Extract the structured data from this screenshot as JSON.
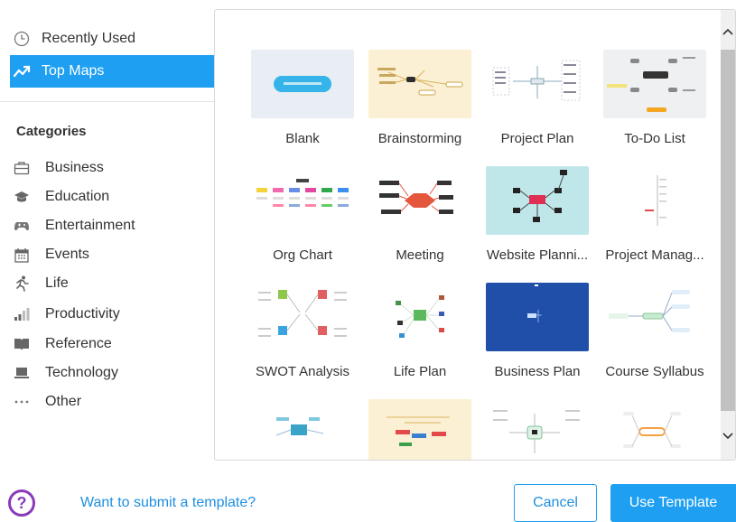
{
  "sidebar": {
    "nav": [
      {
        "label": "Recently Used",
        "icon": "clock-icon"
      },
      {
        "label": "Top Maps",
        "icon": "trending-icon",
        "active": true
      }
    ],
    "categories_title": "Categories",
    "categories": [
      {
        "label": "Business",
        "icon": "briefcase-icon"
      },
      {
        "label": "Education",
        "icon": "graduation-cap-icon"
      },
      {
        "label": "Entertainment",
        "icon": "gamepad-icon"
      },
      {
        "label": "Events",
        "icon": "calendar-icon"
      },
      {
        "label": "Life",
        "icon": "running-person-icon"
      },
      {
        "label": "Productivity",
        "icon": "bar-chart-icon"
      },
      {
        "label": "Reference",
        "icon": "book-icon"
      },
      {
        "label": "Technology",
        "icon": "laptop-icon"
      },
      {
        "label": "Other",
        "icon": "ellipsis-icon"
      }
    ]
  },
  "templates": [
    {
      "label": "Blank",
      "thumb_bg": "#e8eef3"
    },
    {
      "label": "Brainstorming",
      "thumb_bg": "#fbf0d4"
    },
    {
      "label": "Project Plan",
      "thumb_bg": "#ffffff"
    },
    {
      "label": "To-Do List",
      "thumb_bg": "#eef0f2"
    },
    {
      "label": "Org Chart",
      "thumb_bg": "#ffffff"
    },
    {
      "label": "Meeting",
      "thumb_bg": "#ffffff"
    },
    {
      "label": "Website Planni...",
      "thumb_bg": "#bfe7ea"
    },
    {
      "label": "Project Manag...",
      "thumb_bg": "#ffffff"
    },
    {
      "label": "SWOT Analysis",
      "thumb_bg": "#ffffff"
    },
    {
      "label": "Life Plan",
      "thumb_bg": "#ffffff"
    },
    {
      "label": "Business Plan",
      "thumb_bg": "#1f4fa8"
    },
    {
      "label": "Course Syllabus",
      "thumb_bg": "#ffffff"
    },
    {
      "label": "",
      "thumb_bg": "#ffffff"
    },
    {
      "label": "",
      "thumb_bg": "#fbf0d4"
    },
    {
      "label": "",
      "thumb_bg": "#ffffff"
    },
    {
      "label": "",
      "thumb_bg": "#ffffff"
    }
  ],
  "footer": {
    "help_icon": "?",
    "submit_link": "Want to submit a template?",
    "cancel_label": "Cancel",
    "use_label": "Use Template"
  },
  "colors": {
    "accent": "#1e9ff2",
    "help_purple": "#8a3ab9"
  }
}
